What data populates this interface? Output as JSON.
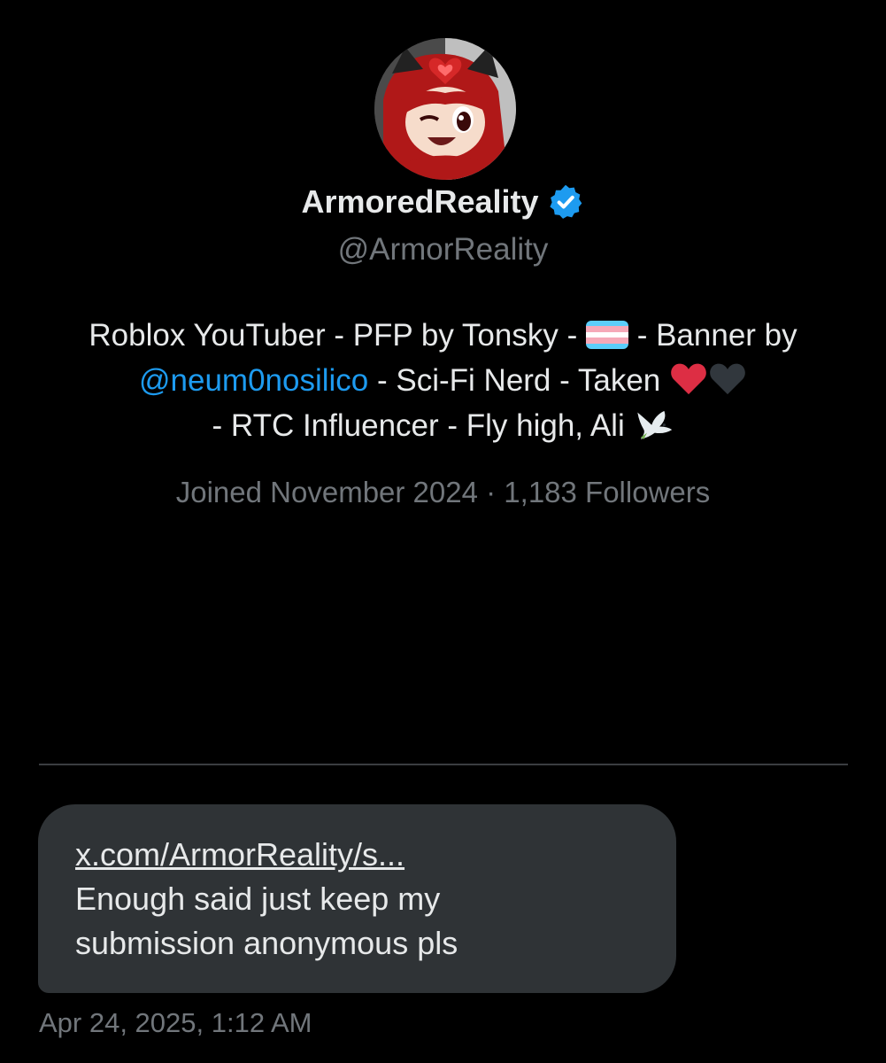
{
  "profile": {
    "display_name": "ArmoredReality",
    "verified_icon": "verified-badge-icon",
    "handle": "@ArmorReality",
    "bio": {
      "part1": "Roblox YouTuber - PFP by Tonsky - ",
      "flag_icon": "transgender-flag-icon",
      "part2": " - Banner by ",
      "mention": "@neum0nosilico",
      "part3": " - Sci-Fi Nerd - Taken ",
      "heart_icons": [
        "red-heart-icon",
        "black-heart-icon"
      ],
      "part4": " - RTC Influencer - Fly high, Ali ",
      "dove_icon": "dove-icon"
    },
    "meta": "Joined November 2024 · 1,183 Followers"
  },
  "message": {
    "link": "x.com/ArmorReality/s...",
    "line1": "Enough said just keep my",
    "line2": "submission anonymous pls",
    "timestamp": "Apr 24, 2025, 1:12 AM"
  },
  "colors": {
    "background": "#000000",
    "text": "#e7e9ea",
    "muted": "#71767b",
    "accent": "#1d9bf0",
    "bubble": "#2f3336"
  }
}
